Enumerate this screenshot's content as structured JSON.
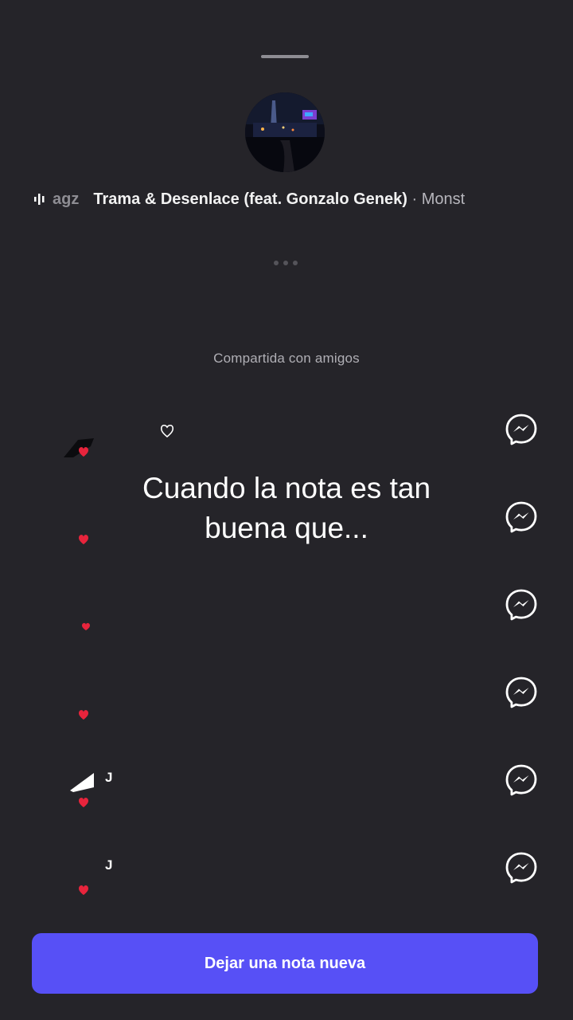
{
  "song": {
    "artist": "agz",
    "title": "Trama & Desenlace (feat. Gonzalo Genek)",
    "separator": "·",
    "album": "Monst"
  },
  "section": {
    "label": "Compartida con amigos"
  },
  "friends": [
    {
      "name": "",
      "reaction": "heart",
      "action_icon": "messenger-icon"
    },
    {
      "name": "",
      "reaction": "heart",
      "action_icon": "messenger-icon"
    },
    {
      "name": "",
      "reaction": "heart",
      "action_icon": "messenger-icon"
    },
    {
      "name": "",
      "reaction": "heart",
      "action_icon": "messenger-icon"
    },
    {
      "name": "J",
      "reaction": "heart",
      "action_icon": "messenger-icon"
    },
    {
      "name": "J",
      "reaction": "heart",
      "action_icon": "messenger-icon"
    }
  ],
  "overlay": {
    "line1": "Cuando la nota es tan",
    "line2": "buena que..."
  },
  "cta": {
    "label": "Dejar una nota nueva"
  },
  "colors": {
    "background": "#252429",
    "accent": "#5750f6",
    "heart": "#e8243c"
  }
}
